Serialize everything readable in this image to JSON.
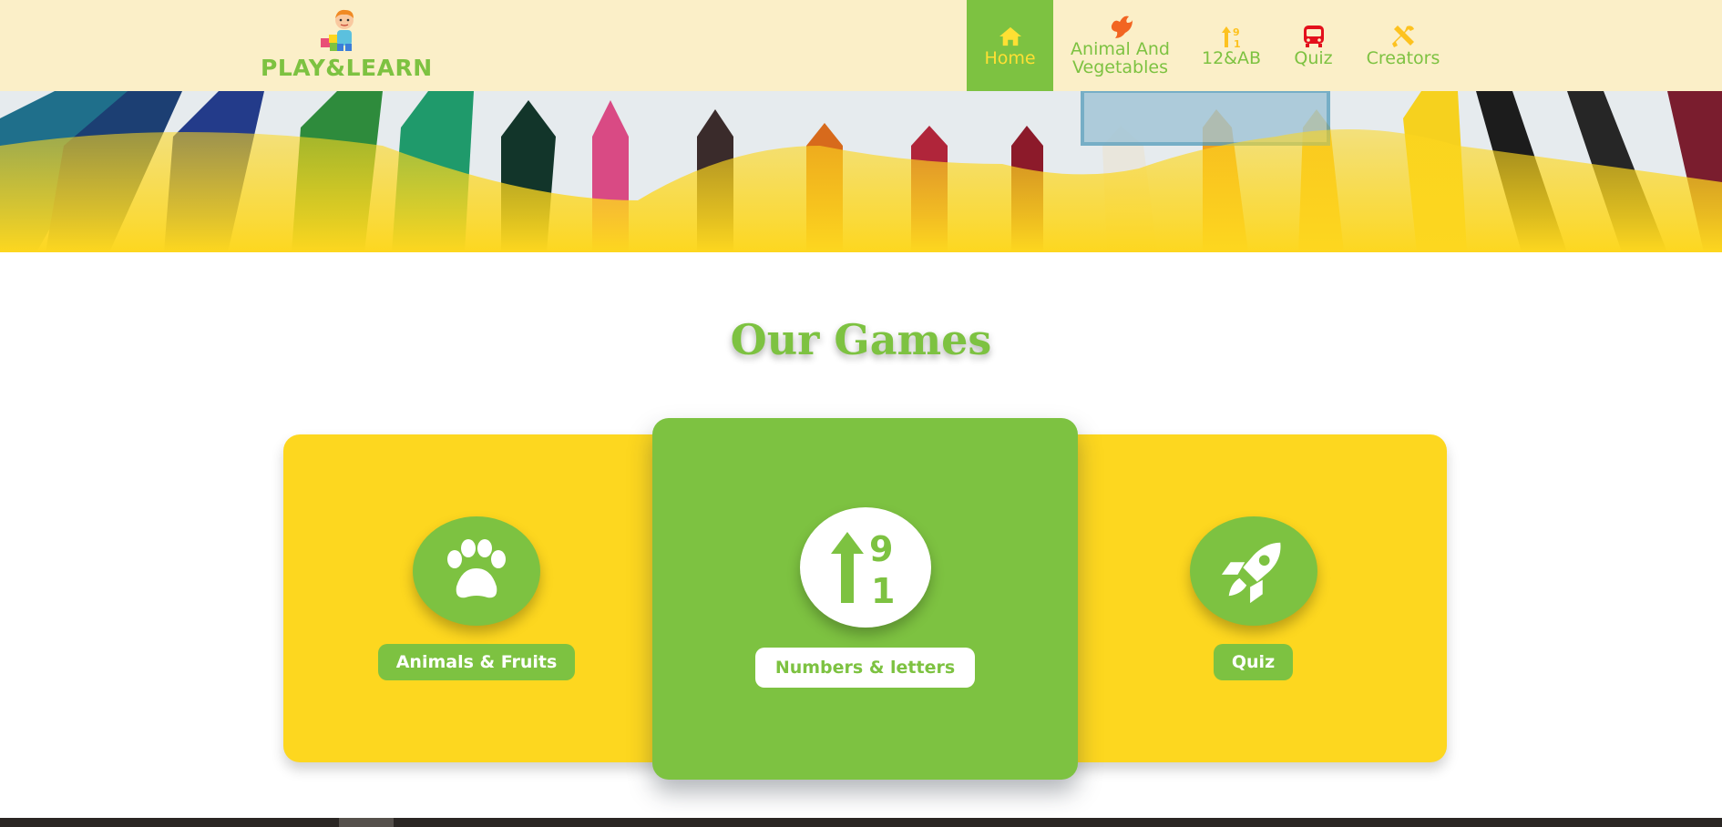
{
  "brand": {
    "name": "PLAY&LEARN",
    "green": "#7dc241",
    "yellow": "#fdd71f",
    "nav_bg": "#fbefc8"
  },
  "nav": {
    "items": [
      {
        "label": "Home",
        "icon": "home-icon",
        "active": true
      },
      {
        "label": "Animal And Vegetables",
        "line1": "Animal And",
        "line2": "Vegetables",
        "icon": "bird-icon",
        "active": false
      },
      {
        "label": "12&AB",
        "icon": "sort-numeric-icon",
        "active": false
      },
      {
        "label": "Quiz",
        "icon": "bus-icon",
        "active": false
      },
      {
        "label": "Creators",
        "icon": "tools-icon",
        "active": false
      }
    ]
  },
  "section": {
    "title": "Our Games"
  },
  "games": [
    {
      "label": "Animals & Fruits",
      "icon": "paw-icon",
      "highlighted": false
    },
    {
      "label": "Numbers & letters",
      "icon": "sort-numeric-up-icon",
      "highlighted": true
    },
    {
      "label": "Quiz",
      "icon": "rocket-icon",
      "highlighted": false
    }
  ]
}
